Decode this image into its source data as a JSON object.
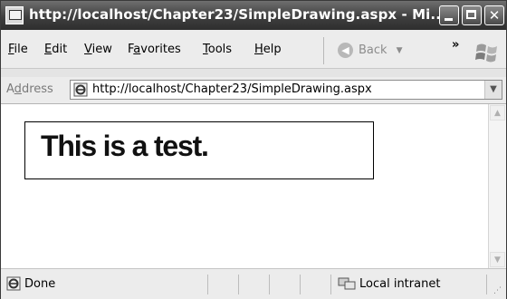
{
  "window": {
    "title": "http://localhost/Chapter23/SimpleDrawing.aspx - Mi..."
  },
  "menu": {
    "items": [
      {
        "key": "F",
        "rest": "ile"
      },
      {
        "key": "E",
        "rest": "dit"
      },
      {
        "key": "V",
        "rest": "iew"
      },
      {
        "pre": "F",
        "key": "a",
        "rest": "vorites"
      },
      {
        "key": "T",
        "rest": "ools"
      },
      {
        "key": "H",
        "rest": "elp"
      }
    ],
    "back_label": "Back",
    "overflow": "»"
  },
  "address": {
    "label_pre": "A",
    "label_key": "d",
    "label_rest": "dress",
    "url": "http://localhost/Chapter23/SimpleDrawing.aspx"
  },
  "page": {
    "drawing_text": "This is a test."
  },
  "status": {
    "text": "Done",
    "zone": "Local intranet"
  }
}
